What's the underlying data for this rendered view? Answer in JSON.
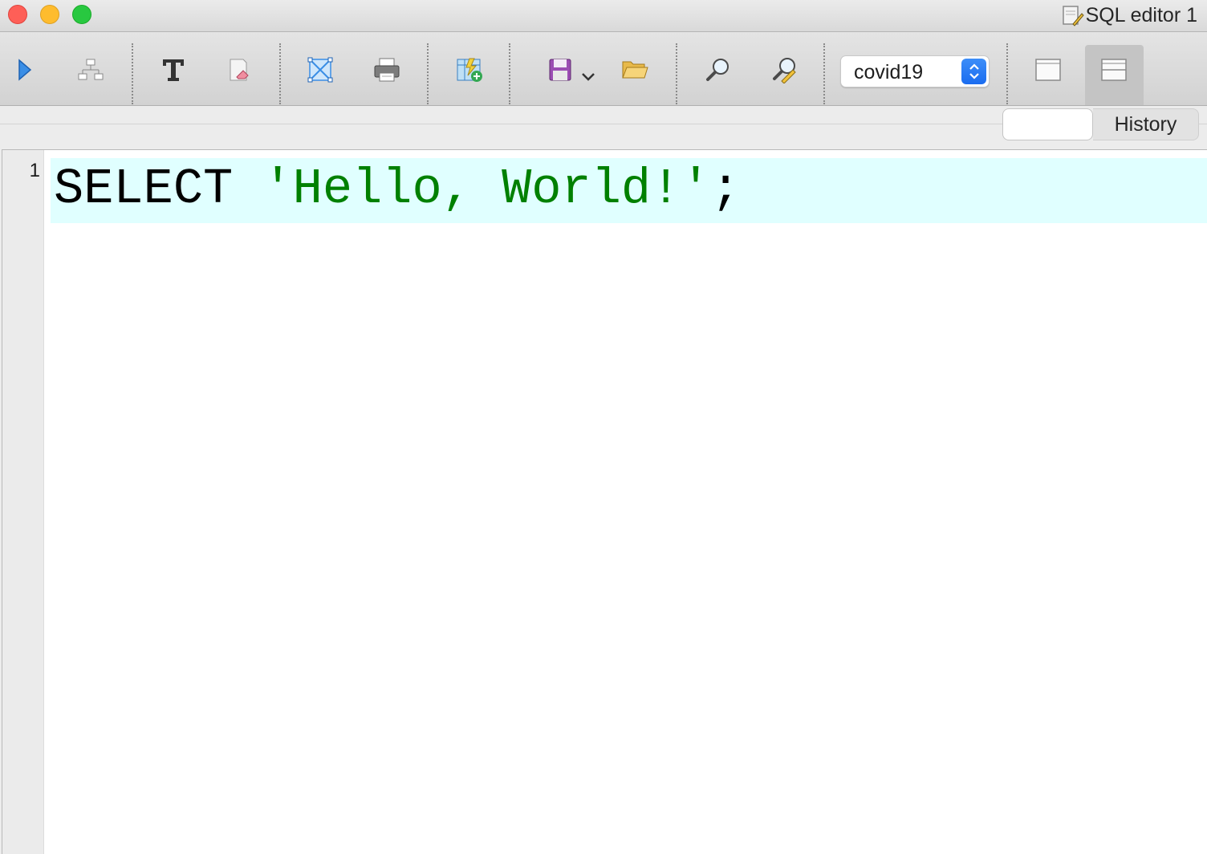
{
  "window": {
    "title": "SQL editor 1",
    "title_icon": "sql-script-icon"
  },
  "toolbar": {
    "buttons": [
      {
        "name": "execute-icon"
      },
      {
        "name": "explain-plan-icon"
      },
      {
        "name": "text-format-icon"
      },
      {
        "name": "clear-icon"
      },
      {
        "name": "select-all-icon"
      },
      {
        "name": "print-icon"
      },
      {
        "name": "create-view-icon"
      },
      {
        "name": "save-icon"
      },
      {
        "name": "open-folder-icon"
      },
      {
        "name": "find-icon"
      },
      {
        "name": "find-replace-icon"
      }
    ],
    "database_select": {
      "value": "covid19",
      "arrow_icon": "up-down-chevron-icon"
    },
    "layout_buttons": [
      {
        "name": "layout-single-icon"
      },
      {
        "name": "layout-split-icon",
        "active": true
      }
    ]
  },
  "tabs": {
    "blank_label": "",
    "history_label": "History"
  },
  "editor": {
    "lines": [
      {
        "number": "1",
        "tokens": [
          {
            "text": "SELECT ",
            "type": "keyword"
          },
          {
            "text": "'Hello, World!'",
            "type": "string"
          },
          {
            "text": ";",
            "type": "punct"
          }
        ]
      }
    ],
    "current_line_color": "#e0ffff",
    "string_color": "#008000"
  },
  "colors": {
    "close": "#fe5f57",
    "minimize": "#febc2e",
    "maximize": "#28c840",
    "select_accent": "#1a6cf0"
  }
}
